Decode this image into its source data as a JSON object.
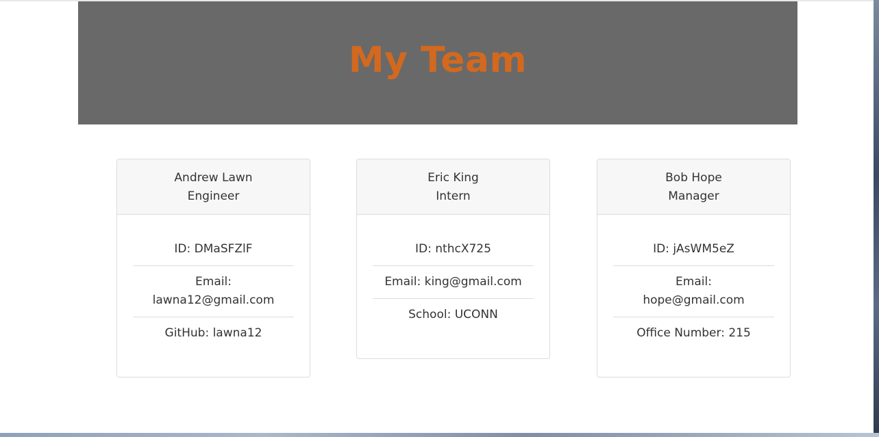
{
  "header": {
    "title": "My Team",
    "title_color": "#d2691e",
    "background_color": "#696969"
  },
  "employees": [
    {
      "name": "Andrew Lawn",
      "role": "Engineer",
      "id": "ID: DMaSFZlF",
      "email_label": "Email:",
      "email": "lawna12@gmail.com",
      "extra": "GitHub: lawna12"
    },
    {
      "name": "Eric King",
      "role": "Intern",
      "id": "ID: nthcX725",
      "email_full": "Email: king@gmail.com",
      "extra": "School: UCONN"
    },
    {
      "name": "Bob Hope",
      "role": "Manager",
      "id": "ID: jAsWM5eZ",
      "email_label": "Email:",
      "email": "hope@gmail.com",
      "extra": "Office Number: 215"
    }
  ]
}
